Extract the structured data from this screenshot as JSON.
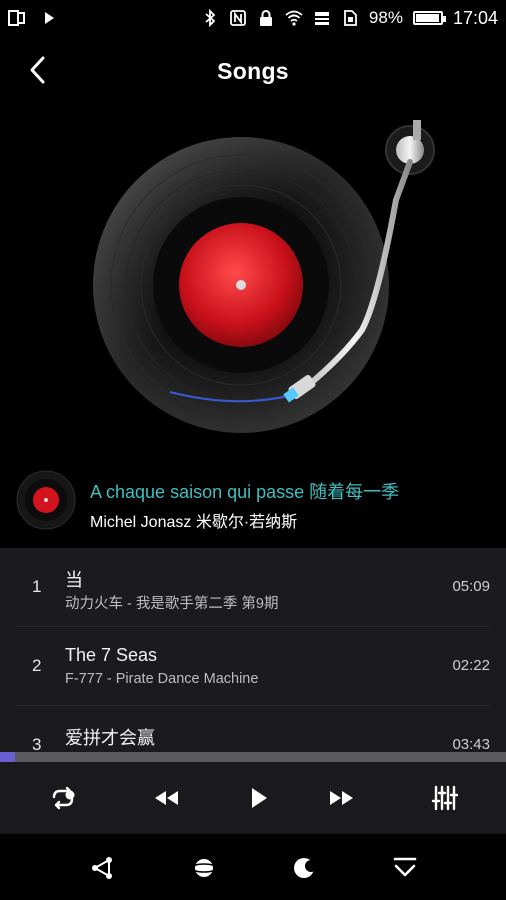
{
  "status_bar": {
    "battery_percent": "98%",
    "battery_level": 0.98,
    "time": "17:04",
    "icons": [
      "recent-apps-icon",
      "play-icon",
      "bluetooth-icon",
      "nfc-icon",
      "lock-icon",
      "wifi-icon",
      "cellular-signal-icon",
      "sim-icon",
      "battery-icon"
    ]
  },
  "header": {
    "title": "Songs",
    "back_icon": "chevron-left-icon"
  },
  "now_playing": {
    "title": "A chaque saison qui passe 随着每一季",
    "artist": "Michel Jonasz 米歇尔·若纳斯",
    "title_color": "#3fbfbf"
  },
  "songs": [
    {
      "index": "1",
      "title": "当",
      "subtitle": "动力火车 - 我是歌手第二季 第9期",
      "duration": "05:09"
    },
    {
      "index": "2",
      "title": "The 7 Seas",
      "subtitle": "F-777 - Pirate Dance Machine",
      "duration": "02:22"
    },
    {
      "index": "3",
      "title": "爱拼才会赢",
      "subtitle": "",
      "duration": "03:43"
    }
  ],
  "playback": {
    "progress_fraction": 0.03,
    "accent_color": "#6a5fd0"
  },
  "controls": {
    "icons": [
      "repeat-icon",
      "rewind-icon",
      "play-icon",
      "fast-forward-icon",
      "equalizer-icon"
    ]
  },
  "bottom_nav": {
    "icons": [
      "share-icon",
      "planet-icon",
      "moon-icon",
      "collapse-icon"
    ]
  }
}
